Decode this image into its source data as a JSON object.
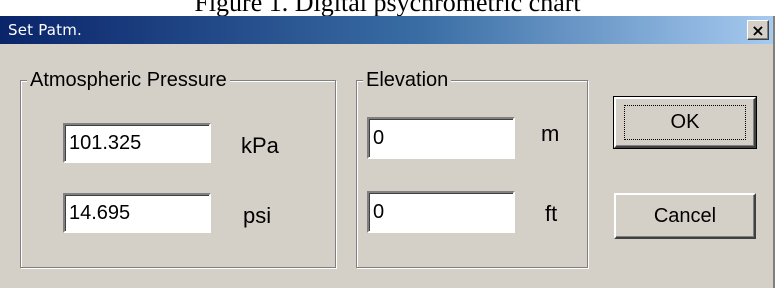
{
  "caption": "Figure 1. Digital psychrometric chart",
  "dialog": {
    "title": "Set Patm.",
    "close_glyph": "×",
    "close_icon": "close-icon"
  },
  "pressure_group": {
    "label": "Atmospheric Pressure",
    "kpa_value": "101.325",
    "kpa_unit": "kPa",
    "psi_value": "14.695",
    "psi_unit": "psi"
  },
  "elevation_group": {
    "label": "Elevation",
    "m_value": "0",
    "m_unit": "m",
    "ft_value": "0",
    "ft_unit": "ft"
  },
  "buttons": {
    "ok_label": "OK",
    "cancel_label": "Cancel"
  }
}
